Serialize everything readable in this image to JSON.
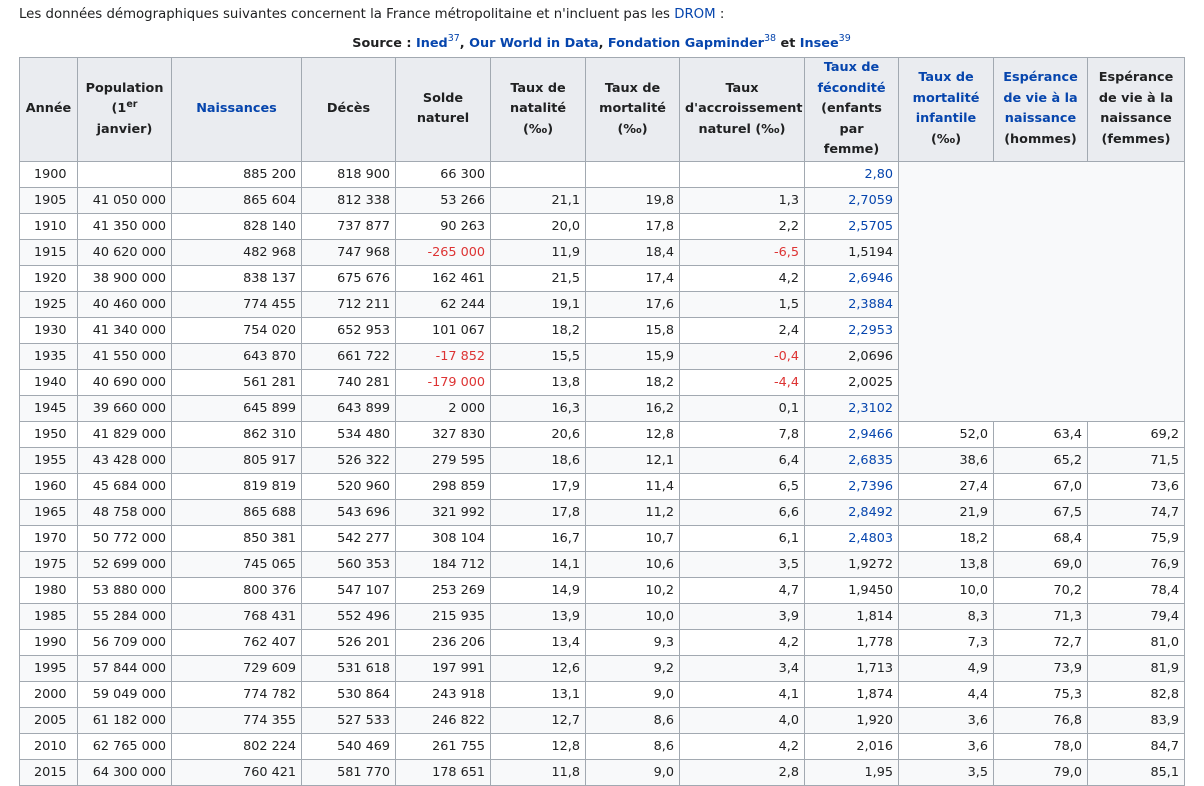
{
  "intro": {
    "text_before": "Les données démographiques suivantes concernent la France métropolitaine et n'incluent pas les ",
    "link": "DROM",
    "text_after": " :"
  },
  "caption": {
    "label": "Source : ",
    "ined": "Ined",
    "ref37": "37",
    "sep1": ", ",
    "owid": "Our World in Data",
    "sep2": ", ",
    "gapminder": "Fondation Gapminder",
    "ref38": "38",
    "sep3": " et ",
    "insee": "Insee",
    "ref39": "39"
  },
  "headers": {
    "annee": "Année",
    "population_a": "Population (1",
    "population_sup": "er",
    "population_b": " janvier)",
    "naissances": "Naissances",
    "deces": "Décès",
    "solde": "Solde naturel",
    "natalite": "Taux de natalité (‰)",
    "mortalite": "Taux de mortalité (‰)",
    "accroissement": "Taux d'accroissement naturel (‰)",
    "fecondite_a": "Taux de fécondité",
    "fecondite_b": "(enfants par femme)",
    "infantile_a": "Taux de mortalité infantile",
    "infantile_b": "(‰)",
    "esp_h_a": "Espérance de vie à la naissance",
    "esp_h_b": "(hommes)",
    "esp_f": "Espérance de vie à la naissance (femmes)"
  },
  "rows": [
    [
      "1900",
      "",
      "885 200",
      "818 900",
      "66 300",
      "",
      "",
      "",
      "2,80",
      "",
      "",
      ""
    ],
    [
      "1905",
      "41 050 000",
      "865 604",
      "812 338",
      "53 266",
      "21,1",
      "19,8",
      "1,3",
      "2,7059",
      "",
      "",
      ""
    ],
    [
      "1910",
      "41 350 000",
      "828 140",
      "737 877",
      "90 263",
      "20,0",
      "17,8",
      "2,2",
      "2,5705",
      "",
      "",
      ""
    ],
    [
      "1915",
      "40 620 000",
      "482 968",
      "747 968",
      "-265 000",
      "11,9",
      "18,4",
      "-6,5",
      "1,5194",
      "",
      "",
      ""
    ],
    [
      "1920",
      "38 900 000",
      "838 137",
      "675 676",
      "162 461",
      "21,5",
      "17,4",
      "4,2",
      "2,6946",
      "",
      "",
      ""
    ],
    [
      "1925",
      "40 460 000",
      "774 455",
      "712 211",
      "62 244",
      "19,1",
      "17,6",
      "1,5",
      "2,3884",
      "",
      "",
      ""
    ],
    [
      "1930",
      "41 340 000",
      "754 020",
      "652 953",
      "101 067",
      "18,2",
      "15,8",
      "2,4",
      "2,2953",
      "",
      "",
      ""
    ],
    [
      "1935",
      "41 550 000",
      "643 870",
      "661 722",
      "-17 852",
      "15,5",
      "15,9",
      "-0,4",
      "2,0696",
      "",
      "",
      ""
    ],
    [
      "1940",
      "40 690 000",
      "561 281",
      "740 281",
      "-179 000",
      "13,8",
      "18,2",
      "-4,4",
      "2,0025",
      "",
      "",
      ""
    ],
    [
      "1945",
      "39 660 000",
      "645 899",
      "643 899",
      "2 000",
      "16,3",
      "16,2",
      "0,1",
      "2,3102",
      "",
      "",
      ""
    ],
    [
      "1950",
      "41 829 000",
      "862 310",
      "534 480",
      "327 830",
      "20,6",
      "12,8",
      "7,8",
      "2,9466",
      "52,0",
      "63,4",
      "69,2"
    ],
    [
      "1955",
      "43 428 000",
      "805 917",
      "526 322",
      "279 595",
      "18,6",
      "12,1",
      "6,4",
      "2,6835",
      "38,6",
      "65,2",
      "71,5"
    ],
    [
      "1960",
      "45 684 000",
      "819 819",
      "520 960",
      "298 859",
      "17,9",
      "11,4",
      "6,5",
      "2,7396",
      "27,4",
      "67,0",
      "73,6"
    ],
    [
      "1965",
      "48 758 000",
      "865 688",
      "543 696",
      "321 992",
      "17,8",
      "11,2",
      "6,6",
      "2,8492",
      "21,9",
      "67,5",
      "74,7"
    ],
    [
      "1970",
      "50 772 000",
      "850 381",
      "542 277",
      "308 104",
      "16,7",
      "10,7",
      "6,1",
      "2,4803",
      "18,2",
      "68,4",
      "75,9"
    ],
    [
      "1975",
      "52 699 000",
      "745 065",
      "560 353",
      "184 712",
      "14,1",
      "10,6",
      "3,5",
      "1,9272",
      "13,8",
      "69,0",
      "76,9"
    ],
    [
      "1980",
      "53 880 000",
      "800 376",
      "547 107",
      "253 269",
      "14,9",
      "10,2",
      "4,7",
      "1,9450",
      "10,0",
      "70,2",
      "78,4"
    ],
    [
      "1985",
      "55 284 000",
      "768 431",
      "552 496",
      "215 935",
      "13,9",
      "10,0",
      "3,9",
      "1,814",
      "8,3",
      "71,3",
      "79,4"
    ],
    [
      "1990",
      "56 709 000",
      "762 407",
      "526 201",
      "236 206",
      "13,4",
      "9,3",
      "4,2",
      "1,778",
      "7,3",
      "72,7",
      "81,0"
    ],
    [
      "1995",
      "57 844 000",
      "729 609",
      "531 618",
      "197 991",
      "12,6",
      "9,2",
      "3,4",
      "1,713",
      "4,9",
      "73,9",
      "81,9"
    ],
    [
      "2000",
      "59 049 000",
      "774 782",
      "530 864",
      "243 918",
      "13,1",
      "9,0",
      "4,1",
      "1,874",
      "4,4",
      "75,3",
      "82,8"
    ],
    [
      "2005",
      "61 182 000",
      "774 355",
      "527 533",
      "246 822",
      "12,7",
      "8,6",
      "4,0",
      "1,920",
      "3,6",
      "76,8",
      "83,9"
    ],
    [
      "2010",
      "62 765 000",
      "802 224",
      "540 469",
      "261 755",
      "12,8",
      "8,6",
      "4,2",
      "2,016",
      "3,6",
      "78,0",
      "84,7"
    ],
    [
      "2015",
      "64 300 000",
      "760 421",
      "581 770",
      "178 651",
      "11,8",
      "9,0",
      "2,8",
      "1,95",
      "3,5",
      "79,0",
      "85,1"
    ]
  ],
  "colors": {
    "link": "#0645ad",
    "negative": "#d33",
    "header_bg": "#eaecf0",
    "border": "#a2a9b1"
  }
}
